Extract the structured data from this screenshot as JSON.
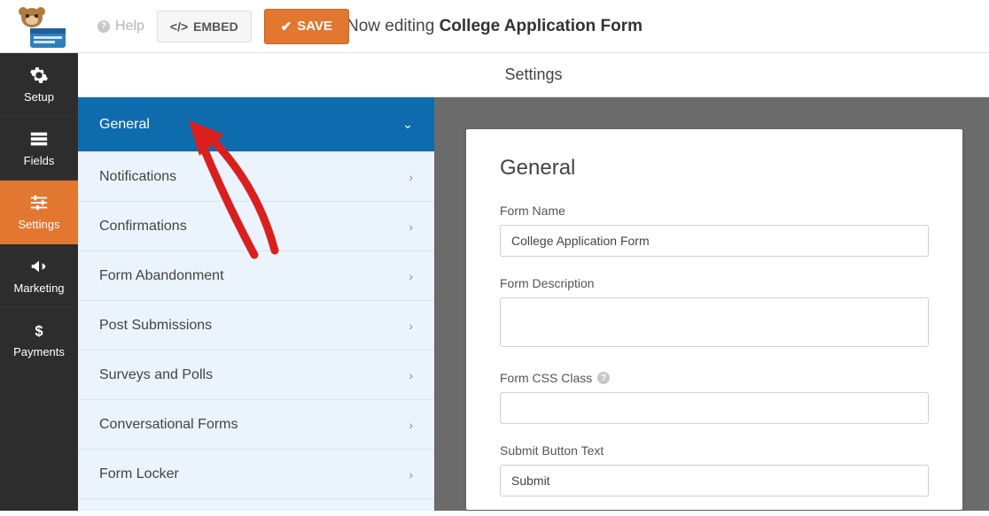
{
  "header": {
    "editing_prefix": "Now editing ",
    "editing_title": "College Application Form",
    "help_label": "Help",
    "embed_label": "EMBED",
    "save_label": "SAVE"
  },
  "leftbar": {
    "items": [
      {
        "label": "Setup"
      },
      {
        "label": "Fields"
      },
      {
        "label": "Settings"
      },
      {
        "label": "Marketing"
      },
      {
        "label": "Payments"
      }
    ],
    "active_index": 2
  },
  "settings_header": "Settings",
  "settings_list": {
    "items": [
      {
        "label": "General"
      },
      {
        "label": "Notifications"
      },
      {
        "label": "Confirmations"
      },
      {
        "label": "Form Abandonment"
      },
      {
        "label": "Post Submissions"
      },
      {
        "label": "Surveys and Polls"
      },
      {
        "label": "Conversational Forms"
      },
      {
        "label": "Form Locker"
      }
    ],
    "active_index": 0
  },
  "form_panel": {
    "title": "General",
    "fields": {
      "form_name": {
        "label": "Form Name",
        "value": "College Application Form"
      },
      "form_description": {
        "label": "Form Description",
        "value": ""
      },
      "form_css_class": {
        "label": "Form CSS Class",
        "value": ""
      },
      "submit_button_text": {
        "label": "Submit Button Text",
        "value": "Submit"
      }
    }
  },
  "colors": {
    "accent": "#e27730",
    "sidebar_dark": "#2d2d2d",
    "settings_blue": "#0e6cae",
    "settings_light": "#ebf3fc",
    "arrow": "#d9201f"
  }
}
